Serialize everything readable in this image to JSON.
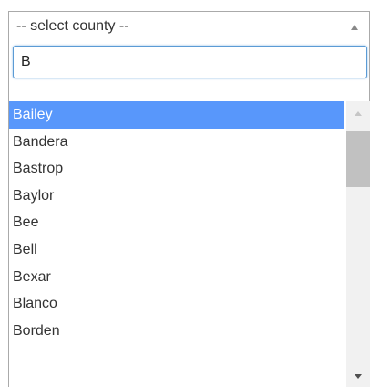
{
  "select": {
    "selected_label": "-- select county --"
  },
  "search": {
    "value": "B"
  },
  "options": [
    {
      "label": "Bailey",
      "highlighted": true
    },
    {
      "label": "Bandera",
      "highlighted": false
    },
    {
      "label": "Bastrop",
      "highlighted": false
    },
    {
      "label": "Baylor",
      "highlighted": false
    },
    {
      "label": "Bee",
      "highlighted": false
    },
    {
      "label": "Bell",
      "highlighted": false
    },
    {
      "label": "Bexar",
      "highlighted": false
    },
    {
      "label": "Blanco",
      "highlighted": false
    },
    {
      "label": "Borden",
      "highlighted": false
    }
  ],
  "colors": {
    "highlight": "#5897fb",
    "focus_border": "#5b9bd5"
  },
  "icons": {
    "select_arrow": "caret-up-icon",
    "scroll_up": "scroll-up-arrow-icon",
    "scroll_down": "scroll-down-arrow-icon"
  }
}
